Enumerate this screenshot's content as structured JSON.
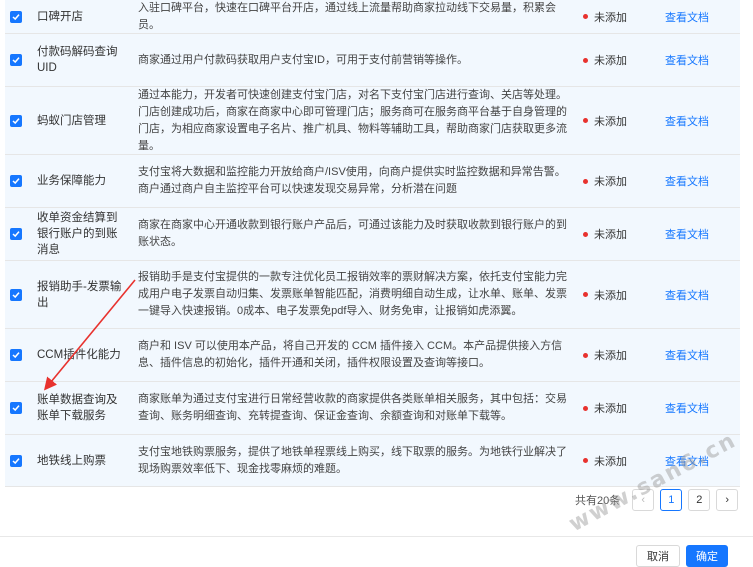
{
  "rows": [
    {
      "name": "口碑开店",
      "desc": "入驻口碑平台，快速在口碑平台开店，通过线上流量帮助商家拉动线下交易量，积累会员。",
      "status": "未添加",
      "link": "查看文档"
    },
    {
      "name": "付款码解码查询UID",
      "desc": "商家通过用户付款码获取用户支付宝ID，可用于支付前营销等操作。",
      "status": "未添加",
      "link": "查看文档"
    },
    {
      "name": "蚂蚁门店管理",
      "desc": "通过本能力，开发者可快速创建支付宝门店，对名下支付宝门店进行查询、关店等处理。门店创建成功后，商家在商家中心即可管理门店；服务商可在服务商平台基于自身管理的门店，为相应商家设置电子名片、推广机具、物料等辅助工具，帮助商家门店获取更多流量。",
      "status": "未添加",
      "link": "查看文档"
    },
    {
      "name": "业务保障能力",
      "desc": "支付宝将大数据和监控能力开放给商户/ISV使用，向商户提供实时监控数据和异常告警。商户通过商户自主监控平台可以快速发现交易异常，分析潜在问题",
      "status": "未添加",
      "link": "查看文档"
    },
    {
      "name": "收单资金结算到银行账户的到账消息",
      "desc": "商家在商家中心开通收款到银行账户产品后，可通过该能力及时获取收款到银行账户的到账状态。",
      "status": "未添加",
      "link": "查看文档"
    },
    {
      "name": "报销助手-发票输出",
      "desc": "报销助手是支付宝提供的一款专注优化员工报销效率的票财解决方案，依托支付宝能力完成用户电子发票自动归集、发票账单智能匹配，消费明细自动生成，让水单、账单、发票一键导入快速报销。0成本、电子发票免pdf导入、财务免审，让报销如虎添翼。",
      "status": "未添加",
      "link": "查看文档"
    },
    {
      "name": "CCM插件化能力",
      "desc": "商户和 ISV 可以使用本产品，将自己开发的 CCM 插件接入 CCM。本产品提供接入方信息、插件信息的初始化，插件开通和关闭，插件权限设置及查询等接口。",
      "status": "未添加",
      "link": "查看文档"
    },
    {
      "name": "账单数据查询及账单下载服务",
      "desc": "商家账单为通过支付宝进行日常经营收款的商家提供各类账单相关服务，其中包括：交易查询、账务明细查询、充转提查询、保证金查询、余额查询和对账单下载等。",
      "status": "未添加",
      "link": "查看文档"
    },
    {
      "name": "地铁线上购票",
      "desc": "支付宝地铁购票服务，提供了地铁单程票线上购买，线下取票的服务。为地铁行业解决了现场购票效率低下、现金找零麻烦的难题。",
      "status": "未添加",
      "link": "查看文档"
    }
  ],
  "pagination": {
    "total": "共有20条",
    "pages": [
      "1",
      "2"
    ],
    "prev": "‹",
    "next": "›"
  },
  "footer": {
    "cancel": "取消",
    "ok": "确定"
  },
  "watermark": "www.san6.cn",
  "colors": {
    "accent": "#1677ff",
    "status_dot": "#e8322e",
    "arrow": "#e8322e",
    "row_bg": "#f2f8fe"
  }
}
